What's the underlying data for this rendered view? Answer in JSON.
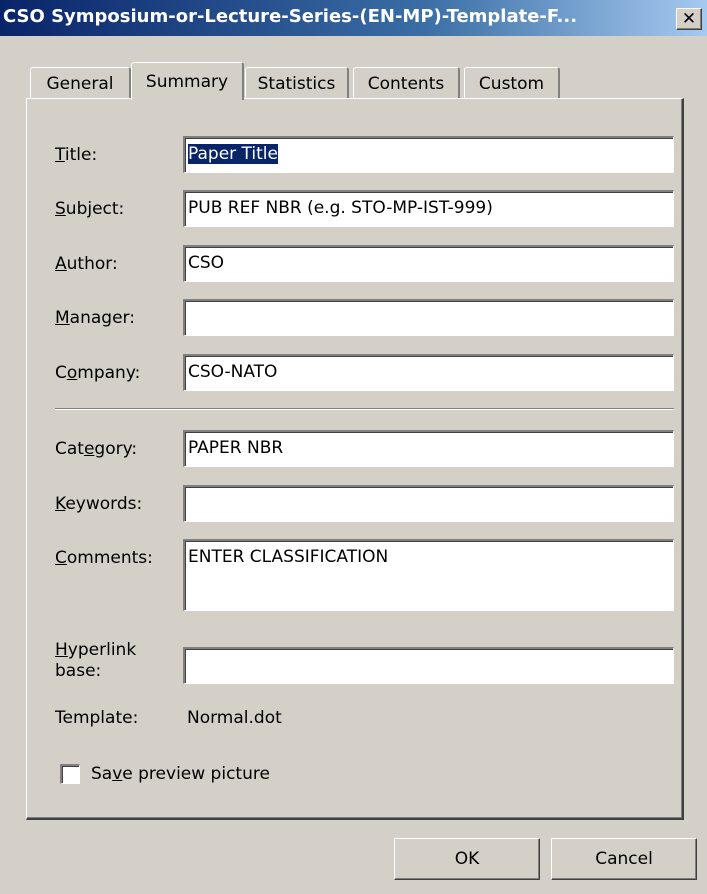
{
  "window": {
    "title": "CSO Symposium-or-Lecture-Series-(EN-MP)-Template-F...",
    "close_glyph": "✕"
  },
  "tabs": [
    {
      "label": "General",
      "active": false
    },
    {
      "label": "Summary",
      "active": true
    },
    {
      "label": "Statistics",
      "active": false
    },
    {
      "label": "Contents",
      "active": false
    },
    {
      "label": "Custom",
      "active": false
    }
  ],
  "fields": {
    "title": {
      "label_pre": "",
      "label_ul": "T",
      "label_post": "itle:",
      "value": "Paper Title"
    },
    "subject": {
      "label_pre": "",
      "label_ul": "S",
      "label_post": "ubject:",
      "value": "PUB REF NBR (e.g. STO-MP-IST-999)"
    },
    "author": {
      "label_pre": "",
      "label_ul": "A",
      "label_post": "uthor:",
      "value": "CSO"
    },
    "manager": {
      "label_pre": "",
      "label_ul": "M",
      "label_post": "anager:",
      "value": ""
    },
    "company": {
      "label_pre": "C",
      "label_ul": "o",
      "label_post": "mpany:",
      "value": "CSO-NATO"
    },
    "category": {
      "label_pre": "Cat",
      "label_ul": "e",
      "label_post": "gory:",
      "value": "PAPER NBR"
    },
    "keywords": {
      "label_pre": "",
      "label_ul": "K",
      "label_post": "eywords:",
      "value": ""
    },
    "comments": {
      "label_pre": "",
      "label_ul": "C",
      "label_post": "omments:",
      "value": "ENTER CLASSIFICATION"
    },
    "hyperlink": {
      "label_pre": "",
      "label_ul": "H",
      "label_post": "yperlink",
      "label_line2": "base:",
      "value": ""
    }
  },
  "template": {
    "label": "Template:",
    "value": "Normal.dot"
  },
  "save_preview": {
    "label_pre": "Sa",
    "label_ul": "v",
    "label_post": "e preview picture",
    "checked": false
  },
  "buttons": {
    "ok": "OK",
    "cancel": "Cancel"
  }
}
